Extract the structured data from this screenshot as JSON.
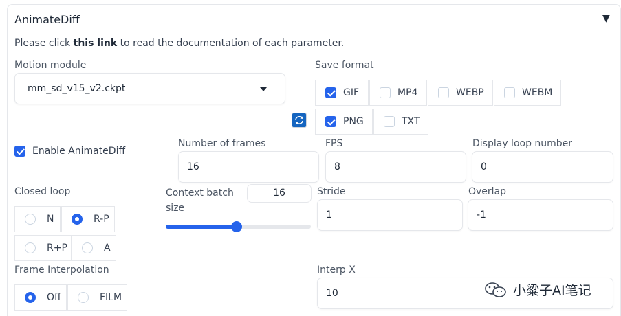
{
  "panel": {
    "title": "AnimateDiff"
  },
  "description": {
    "before": "Please click ",
    "link": "this link",
    "after": " to read the documentation of each parameter."
  },
  "motion_module": {
    "label": "Motion module",
    "value": "mm_sd_v15_v2.ckpt"
  },
  "save_format": {
    "label": "Save format",
    "options": [
      {
        "label": "GIF",
        "checked": true
      },
      {
        "label": "MP4",
        "checked": false
      },
      {
        "label": "WEBP",
        "checked": false
      },
      {
        "label": "WEBM",
        "checked": false
      },
      {
        "label": "PNG",
        "checked": true
      },
      {
        "label": "TXT",
        "checked": false
      }
    ]
  },
  "enable": {
    "label": "Enable AnimateDiff",
    "checked": true
  },
  "number_of_frames": {
    "label": "Number of frames",
    "value": "16"
  },
  "fps": {
    "label": "FPS",
    "value": "8"
  },
  "display_loop": {
    "label": "Display loop number",
    "value": "0"
  },
  "closed_loop": {
    "label": "Closed loop",
    "options": [
      "N",
      "R-P",
      "R+P",
      "A"
    ],
    "selected": "R-P"
  },
  "context_batch": {
    "label": "Context batch size",
    "value": "16",
    "fraction": 0.49
  },
  "stride": {
    "label": "Stride",
    "value": "1"
  },
  "overlap": {
    "label": "Overlap",
    "value": "-1"
  },
  "frame_interpolation": {
    "label": "Frame Interpolation",
    "options": [
      "Off",
      "FILM"
    ],
    "selected": "Off"
  },
  "interp_x": {
    "label": "Interp X",
    "value": "10"
  },
  "watermark": {
    "text": "小粱子AI笔记"
  },
  "colors": {
    "accent": "#2563eb",
    "border": "#e5e7eb",
    "text": "#1f2937"
  }
}
